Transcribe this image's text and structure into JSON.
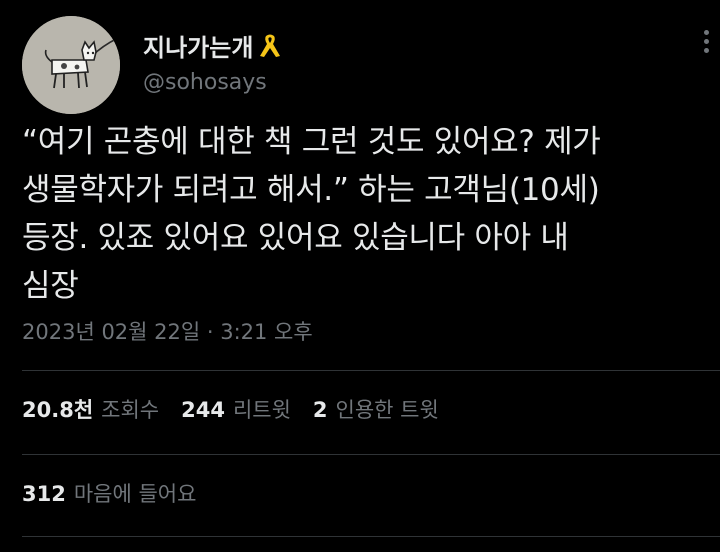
{
  "author": {
    "display_name": "지나가는개",
    "handle": "@sohosays",
    "avatar_icon": "dog-drawing-avatar",
    "badge_icon": "yellow-ribbon-icon"
  },
  "tweet": {
    "text": "“여기 곤충에 대한 책 그런 것도 있어요? 제가\n생물학자가 되려고 해서.” 하는 고객님(10세)\n등장. 있죠 있어요 있어요 있습니다 아아 내\n심장",
    "timestamp": "2023년 02월 22일 · 3:21 오후"
  },
  "stats": {
    "views_count": "20.8천",
    "views_label": "조회수",
    "retweets_count": "244",
    "retweets_label": "리트윗",
    "quotes_count": "2",
    "quotes_label": "인용한 트윗",
    "likes_count": "312",
    "likes_label": "마음에 들어요"
  },
  "colors": {
    "background": "#000000",
    "primary_text": "#e7e9ea",
    "secondary_text": "#71767b",
    "divider": "#2f3336",
    "ribbon": "#f5c518"
  }
}
